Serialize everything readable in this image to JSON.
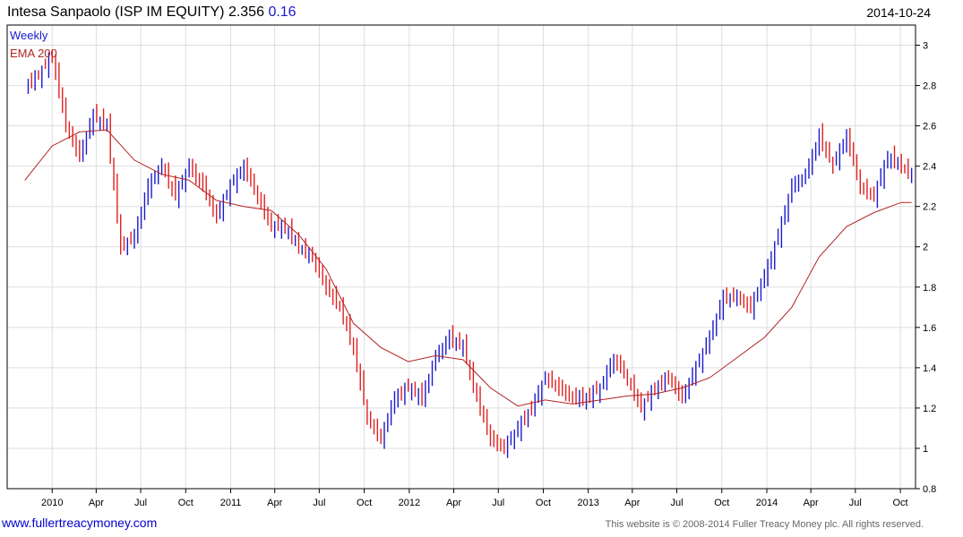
{
  "header": {
    "security": "Intesa Sanpaolo (ISP IM EQUITY)",
    "last_price": "2.356",
    "change": "0.16",
    "date": "2014-10-24"
  },
  "footer": {
    "website": "www.fullertreacymoney.com",
    "copyright": "This website is © 2008-2014 Fuller Treacy Money plc. All rights reserved."
  },
  "colors": {
    "up": "#1a1acc",
    "down": "#e02020",
    "ema": "#b22222",
    "grid": "#dddddd",
    "frame": "#000000"
  },
  "chart_data": {
    "type": "line",
    "ylim": [
      0.8,
      3.1
    ],
    "y_ticks": [
      0.8,
      1,
      1.2,
      1.4,
      1.6,
      1.8,
      2,
      2.2,
      2.4,
      2.6,
      2.8,
      3
    ],
    "y_tick_labels": [
      "0.8",
      "1",
      "1.2",
      "1.4",
      "1.6",
      "1.8",
      "2",
      "2.2",
      "2.4",
      "2.6",
      "2.8",
      "3"
    ],
    "x_labels": [
      "2010",
      "Apr",
      "Jul",
      "Oct",
      "2011",
      "Apr",
      "Jul",
      "Oct",
      "2012",
      "Apr",
      "Jul",
      "Oct",
      "2013",
      "Apr",
      "Jul",
      "Oct",
      "2014",
      "Apr",
      "Jul",
      "Oct"
    ],
    "legend": [
      "Weekly",
      "EMA 200"
    ],
    "grid": true,
    "axis_side": "right",
    "series": [
      {
        "name": "Weekly",
        "x": [
          "2009-11-06",
          "2009-12-04",
          "2010-01-01",
          "2010-01-29",
          "2010-02-26",
          "2010-03-26",
          "2010-04-23",
          "2010-05-21",
          "2010-06-18",
          "2010-07-16",
          "2010-08-13",
          "2010-09-10",
          "2010-10-08",
          "2010-11-05",
          "2010-12-03",
          "2010-12-31",
          "2011-01-28",
          "2011-02-25",
          "2011-03-25",
          "2011-04-22",
          "2011-05-20",
          "2011-06-17",
          "2011-07-15",
          "2011-08-12",
          "2011-09-09",
          "2011-10-07",
          "2011-11-04",
          "2011-12-02",
          "2011-12-30",
          "2012-01-27",
          "2012-02-24",
          "2012-03-23",
          "2012-04-20",
          "2012-05-18",
          "2012-06-15",
          "2012-07-13",
          "2012-08-10",
          "2012-09-07",
          "2012-10-05",
          "2012-11-02",
          "2012-11-30",
          "2012-12-28",
          "2013-01-25",
          "2013-02-22",
          "2013-03-22",
          "2013-04-19",
          "2013-05-17",
          "2013-06-14",
          "2013-07-12",
          "2013-08-09",
          "2013-09-06",
          "2013-10-04",
          "2013-11-01",
          "2013-11-29",
          "2013-12-27",
          "2014-01-24",
          "2014-02-21",
          "2014-03-21",
          "2014-04-18",
          "2014-05-16",
          "2014-06-13",
          "2014-07-11",
          "2014-08-08",
          "2014-09-05",
          "2014-10-03",
          "2014-10-24"
        ],
        "values": [
          2.8,
          2.85,
          2.95,
          2.6,
          2.45,
          2.65,
          2.6,
          2.0,
          2.05,
          2.3,
          2.4,
          2.25,
          2.4,
          2.3,
          2.15,
          2.3,
          2.4,
          2.25,
          2.1,
          2.1,
          2.0,
          1.95,
          1.8,
          1.7,
          1.5,
          1.15,
          1.05,
          1.25,
          1.3,
          1.25,
          1.45,
          1.55,
          1.5,
          1.25,
          1.05,
          1.0,
          1.1,
          1.2,
          1.35,
          1.3,
          1.25,
          1.25,
          1.3,
          1.45,
          1.35,
          1.2,
          1.3,
          1.35,
          1.25,
          1.4,
          1.55,
          1.75,
          1.75,
          1.7,
          1.85,
          2.05,
          2.3,
          2.35,
          2.55,
          2.4,
          2.55,
          2.3,
          2.25,
          2.45,
          2.4,
          2.356
        ]
      },
      {
        "name": "EMA 200",
        "x": [
          "2009-11-06",
          "2010-01-01",
          "2010-02-26",
          "2010-04-23",
          "2010-06-18",
          "2010-08-13",
          "2010-10-08",
          "2010-12-03",
          "2011-01-28",
          "2011-03-25",
          "2011-05-20",
          "2011-07-15",
          "2011-09-09",
          "2011-11-04",
          "2011-12-30",
          "2012-02-24",
          "2012-04-20",
          "2012-06-15",
          "2012-08-10",
          "2012-10-05",
          "2012-11-30",
          "2013-01-25",
          "2013-03-22",
          "2013-05-17",
          "2013-07-12",
          "2013-09-06",
          "2013-11-01",
          "2013-12-27",
          "2014-02-21",
          "2014-04-18",
          "2014-06-13",
          "2014-08-08",
          "2014-10-03",
          "2014-10-24"
        ],
        "values": [
          2.33,
          2.5,
          2.57,
          2.58,
          2.43,
          2.36,
          2.33,
          2.23,
          2.2,
          2.18,
          2.06,
          1.89,
          1.62,
          1.5,
          1.43,
          1.46,
          1.44,
          1.3,
          1.21,
          1.24,
          1.22,
          1.24,
          1.26,
          1.27,
          1.3,
          1.35,
          1.45,
          1.55,
          1.7,
          1.95,
          2.1,
          2.17,
          2.22,
          2.22
        ]
      }
    ]
  }
}
